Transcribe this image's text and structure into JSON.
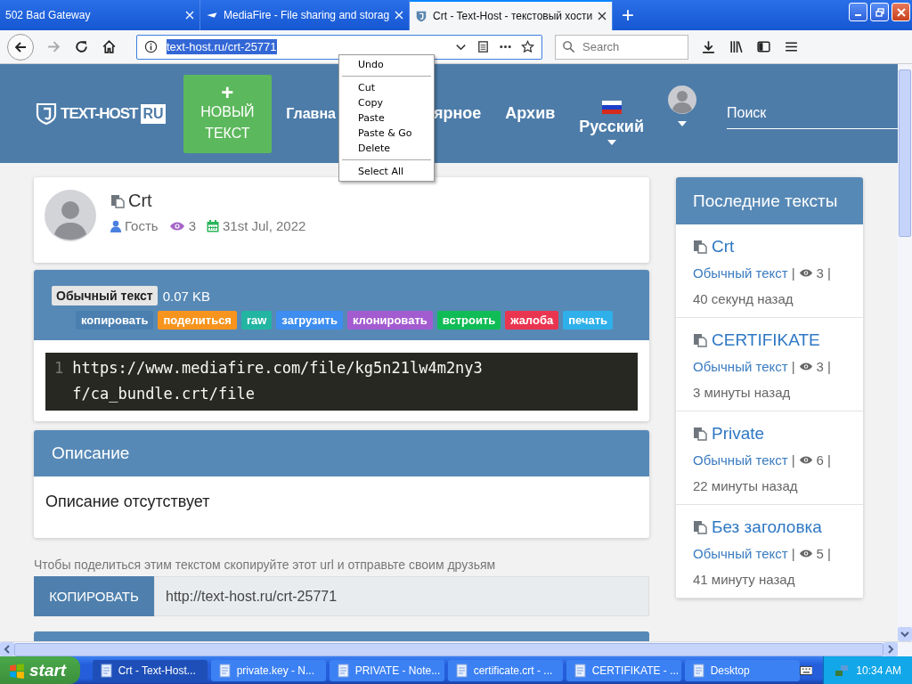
{
  "browser": {
    "tabs": [
      {
        "title": "502 Bad Gateway",
        "selected": false
      },
      {
        "title": "MediaFire - File sharing and storag",
        "selected": false
      },
      {
        "title": "Crt - Text-Host - текстовый хости",
        "selected": true
      }
    ],
    "new_tab": "+",
    "address": {
      "value": "text-host.ru/crt-25771"
    },
    "search": {
      "placeholder": "Search"
    }
  },
  "context_menu": {
    "items": [
      {
        "kind": "item",
        "label": "Undo"
      },
      {
        "kind": "separator"
      },
      {
        "kind": "item",
        "label": "Cut"
      },
      {
        "kind": "item",
        "label": "Copy"
      },
      {
        "kind": "item",
        "label": "Paste"
      },
      {
        "kind": "item",
        "label": "Paste & Go"
      },
      {
        "kind": "item",
        "label": "Delete"
      },
      {
        "kind": "separator"
      },
      {
        "kind": "item",
        "label": "Select All"
      }
    ]
  },
  "site": {
    "logo": "TEXT-HOST",
    "logo_badge": "RU",
    "new_button": {
      "icon": "+",
      "label": "НОВЫЙ ТЕКСТ"
    },
    "nav": [
      "Главна",
      "ярное",
      "Архив"
    ],
    "language": "Русский",
    "search": {
      "placeholder": "Поиск"
    }
  },
  "paste": {
    "title": "Crt",
    "author": "Гость",
    "views": "3",
    "date": "31st Jul, 2022",
    "format": "Обычный текст",
    "size": "0.07 KB",
    "actions": [
      {
        "label": "копировать",
        "color": "#4a7fb0"
      },
      {
        "label": "поделиться",
        "color": "#f7941d"
      },
      {
        "label": "raw",
        "color": "#22b5a2"
      },
      {
        "label": "загрузить",
        "color": "#3d8ef0"
      },
      {
        "label": "клонировать",
        "color": "#a35bd0"
      },
      {
        "label": "встроить",
        "color": "#10bc55"
      },
      {
        "label": "жалоба",
        "color": "#ea3550"
      },
      {
        "label": "печать",
        "color": "#2fb0ea"
      }
    ],
    "code": [
      {
        "number": "1",
        "text": "https://www.mediafire.com/file/kg5n21lw4m2ny3f/ca_bundle.crt/file"
      }
    ]
  },
  "description": {
    "title": "Описание",
    "text": "Описание отсутствует"
  },
  "share": {
    "hint": "Чтобы поделиться этим текстом скопируйте этот url и отправьте своим друзьям",
    "button": "КОПИРОВАТЬ",
    "url": "http://text-host.ru/crt-25771"
  },
  "sidebar": {
    "title": "Последние тексты",
    "items": [
      {
        "title": "Crt",
        "format": "Обычный текст",
        "separators": [
          "|",
          "|"
        ],
        "views": "3",
        "time": "40 секунд назад"
      },
      {
        "title": "CERTIFIKATE",
        "format": "Обычный текст",
        "separators": [
          "|",
          "|"
        ],
        "views": "3",
        "time": "3 минуты назад"
      },
      {
        "title": "Private",
        "format": "Обычный текст",
        "separators": [
          "|",
          "|"
        ],
        "views": "6",
        "time": "22 минуты назад"
      },
      {
        "title": "Без заголовка",
        "format": "Обычный текст",
        "separators": [
          "|",
          "|"
        ],
        "views": "5",
        "time": "41 минуту назад"
      }
    ]
  },
  "taskbar": {
    "start": "start",
    "items": [
      {
        "label": "Crt - Text-Host...",
        "selected": true
      },
      {
        "label": "private.key - N...",
        "selected": false
      },
      {
        "label": "PRIVATE - Note...",
        "selected": false
      },
      {
        "label": "certificate.crt - ...",
        "selected": false
      },
      {
        "label": "CERTIFIKATE - ...",
        "selected": false
      },
      {
        "label": "Desktop",
        "selected": false
      }
    ],
    "clock": "10:34 AM"
  }
}
